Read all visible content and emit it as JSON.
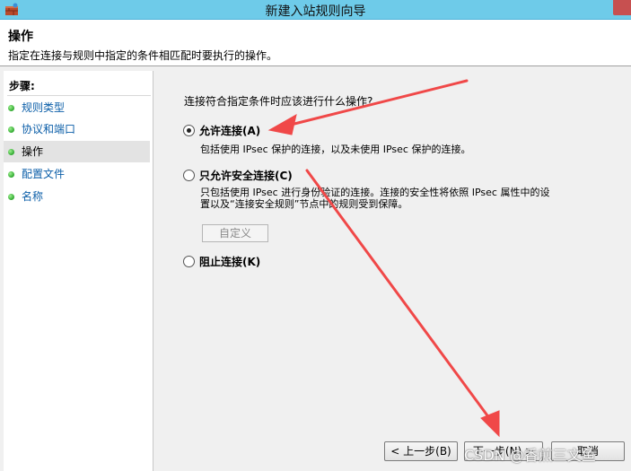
{
  "window": {
    "title": "新建入站规则向导"
  },
  "header": {
    "title": "操作",
    "description": "指定在连接与规则中指定的条件相匹配时要执行的操作。"
  },
  "steps": {
    "title": "步骤:",
    "items": [
      {
        "label": "规则类型",
        "active": false
      },
      {
        "label": "协议和端口",
        "active": false
      },
      {
        "label": "操作",
        "active": true
      },
      {
        "label": "配置文件",
        "active": false
      },
      {
        "label": "名称",
        "active": false
      }
    ]
  },
  "main": {
    "question": "连接符合指定条件时应该进行什么操作?",
    "options": [
      {
        "label": "允许连接(A)",
        "selected": true,
        "description": "包括使用 IPsec 保护的连接，以及未使用 IPsec 保护的连接。"
      },
      {
        "label": "只允许安全连接(C)",
        "selected": false,
        "description_line1": "只包括使用 IPsec 进行身份验证的连接。连接的安全性将依照 IPsec 属性中的设",
        "description_line2": "置以及“连接安全规则”节点中的规则受到保障。"
      },
      {
        "label": "阻止连接(K)",
        "selected": false
      }
    ],
    "customize_label": "自定义"
  },
  "footer": {
    "back_label": "< 上一步(B)",
    "next_label": "下一步(N) >",
    "cancel_label": "取消"
  },
  "watermark": "CSDN @香煎三文鱼",
  "colors": {
    "titlebar": "#6ecbe9",
    "close_button": "#c75050",
    "annotation_arrow": "#f04848",
    "step_link": "#0b5ea8"
  }
}
